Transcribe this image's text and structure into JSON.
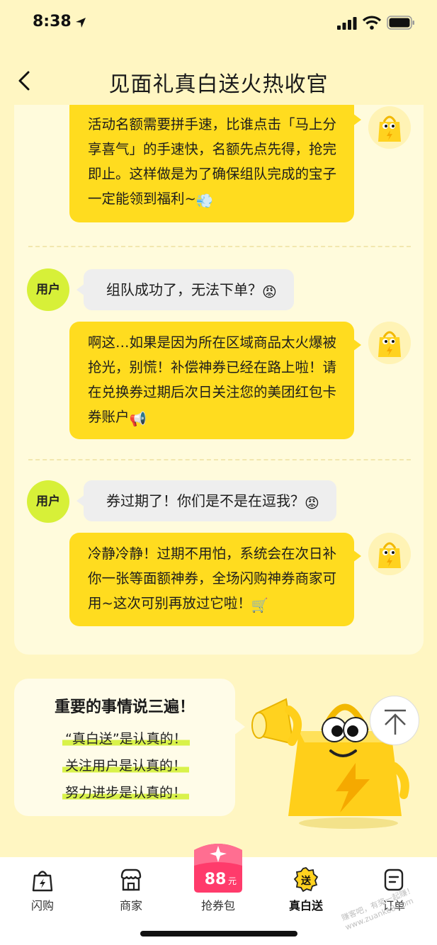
{
  "status_bar": {
    "time": "8:38"
  },
  "header": {
    "title": "见面礼真白送火热收官"
  },
  "conversation": [
    {
      "role": "bot",
      "text": "活动名额需要拼手速，比谁点击「马上分享喜气」的手速快，名额先点先得，抢完即止。这样做是为了确保组队完成的宝子一定能领到福利~",
      "emoji": "💨"
    },
    {
      "role": "user",
      "avatar_label": "用户",
      "text": "组队成功了，无法下单？",
      "emoji": "😡"
    },
    {
      "role": "bot",
      "text": "啊这…如果是因为所在区域商品太火爆被抢光，别慌！补偿神券已经在路上啦！请在兑换券过期后次日关注您的美团红包卡券账户",
      "emoji": "📢"
    },
    {
      "role": "user",
      "avatar_label": "用户",
      "text": "券过期了！你们是不是在逗我？",
      "emoji": "😡"
    },
    {
      "role": "bot",
      "text": "冷静冷静！过期不用怕，系统会在次日补你一张等面额神券，全场闪购神券商家可用~这次可别再放过它啦！",
      "emoji": "🛒"
    }
  ],
  "promo": {
    "title": "重要的事情说三遍！",
    "lines": [
      "“真白送”是认真的！",
      "关注用户是认真的！",
      "努力进步是认真的！"
    ]
  },
  "tabs": [
    {
      "label": "闪购",
      "icon": "shopping-bag-bolt-icon"
    },
    {
      "label": "商家",
      "icon": "store-icon"
    },
    {
      "label": "抢券包",
      "icon": "coupon-pack-icon",
      "badge_text": "88",
      "badge_unit": "元"
    },
    {
      "label": "真白送",
      "icon": "free-gift-badge-icon",
      "icon_text": "送",
      "active": true
    },
    {
      "label": "订单",
      "icon": "order-icon"
    }
  ],
  "watermark": "赚客吧，有奖一起赚！ www.zuanke8.com",
  "colors": {
    "accent_yellow": "#FFDC1F",
    "user_avatar_green": "#D7F038",
    "page_bg": "#FFF6C2",
    "badge_red": "#FF3B6B"
  }
}
